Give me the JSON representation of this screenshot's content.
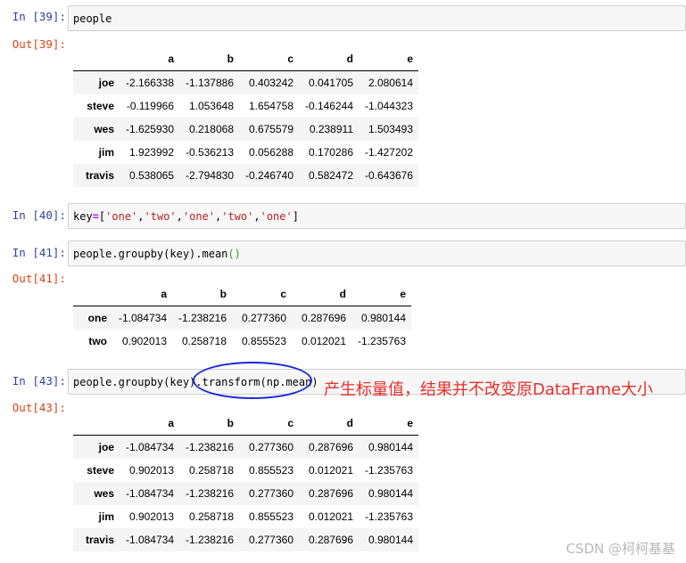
{
  "cells": {
    "c39": {
      "in_prompt": "In  [39]:",
      "code": "people",
      "out_prompt": "Out[39]:"
    },
    "c40": {
      "in_prompt": "In  [40]:",
      "code": {
        "lhs": "key",
        "eq": "=",
        "open": "[",
        "items": [
          "'one'",
          "'two'",
          "'one'",
          "'two'",
          "'one'"
        ],
        "close": "]"
      }
    },
    "c41": {
      "in_prompt": "In  [41]:",
      "code": {
        "pre": "people.groupby(key).mean",
        "parens": "()"
      },
      "out_prompt": "Out[41]:"
    },
    "c43": {
      "in_prompt": "In  [43]:",
      "code": {
        "pre": "people.groupby(key).",
        "hl": "transform(np.mean)"
      },
      "out_prompt": "Out[43]:"
    }
  },
  "df_people": {
    "columns": [
      "a",
      "b",
      "c",
      "d",
      "e"
    ],
    "rows": [
      {
        "index": "joe",
        "values": [
          "-2.166338",
          "-1.137886",
          "0.403242",
          "0.041705",
          "2.080614"
        ]
      },
      {
        "index": "steve",
        "values": [
          "-0.119966",
          "1.053648",
          "1.654758",
          "-0.146244",
          "-1.044323"
        ]
      },
      {
        "index": "wes",
        "values": [
          "-1.625930",
          "0.218068",
          "0.675579",
          "0.238911",
          "1.503493"
        ]
      },
      {
        "index": "jim",
        "values": [
          "1.923992",
          "-0.536213",
          "0.056288",
          "0.170286",
          "-1.427202"
        ]
      },
      {
        "index": "travis",
        "values": [
          "0.538065",
          "-2.794830",
          "-0.246740",
          "0.582472",
          "-0.643676"
        ]
      }
    ]
  },
  "df_mean": {
    "columns": [
      "a",
      "b",
      "c",
      "d",
      "e"
    ],
    "rows": [
      {
        "index": "one",
        "values": [
          "-1.084734",
          "-1.238216",
          "0.277360",
          "0.287696",
          "0.980144"
        ]
      },
      {
        "index": "two",
        "values": [
          "0.902013",
          "0.258718",
          "0.855523",
          "0.012021",
          "-1.235763"
        ]
      }
    ]
  },
  "df_transform": {
    "columns": [
      "a",
      "b",
      "c",
      "d",
      "e"
    ],
    "rows": [
      {
        "index": "joe",
        "values": [
          "-1.084734",
          "-1.238216",
          "0.277360",
          "0.287696",
          "0.980144"
        ]
      },
      {
        "index": "steve",
        "values": [
          "0.902013",
          "0.258718",
          "0.855523",
          "0.012021",
          "-1.235763"
        ]
      },
      {
        "index": "wes",
        "values": [
          "-1.084734",
          "-1.238216",
          "0.277360",
          "0.287696",
          "0.980144"
        ]
      },
      {
        "index": "jim",
        "values": [
          "0.902013",
          "0.258718",
          "0.855523",
          "0.012021",
          "-1.235763"
        ]
      },
      {
        "index": "travis",
        "values": [
          "-1.084734",
          "-1.238216",
          "0.277360",
          "0.287696",
          "0.980144"
        ]
      }
    ]
  },
  "annotation": "产生标量值，结果并不改变原DataFrame大小",
  "watermark": "CSDN @柯柯基基",
  "colors": {
    "in_prompt": "#303f9f",
    "out_prompt": "#d84315",
    "circle": "#1a2ad6",
    "annotation": "#e8302a"
  }
}
